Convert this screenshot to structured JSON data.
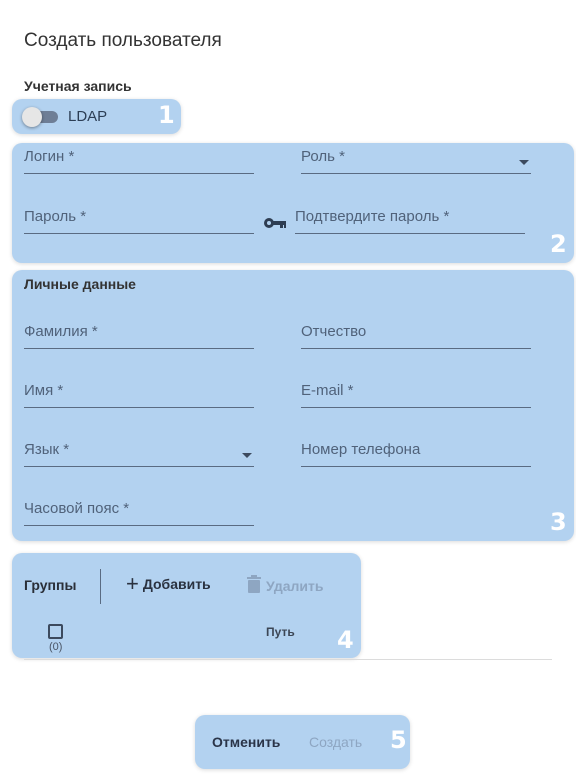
{
  "dialog": {
    "title": "Создать пользователя",
    "account_section": "Учетная запись"
  },
  "ldap": {
    "label": "LDAP",
    "enabled": false
  },
  "account_fields": {
    "login": "Логин *",
    "role": "Роль *",
    "password": "Пароль *",
    "confirm_password": "Подтвердите пароль *"
  },
  "personal": {
    "title": "Личные данные",
    "last_name": "Фамилия *",
    "middle_name": "Отчество",
    "first_name": "Имя *",
    "email": "E-mail *",
    "language": "Язык *",
    "phone": "Номер телефона",
    "timezone": "Часовой пояс *"
  },
  "groups": {
    "title": "Группы",
    "add_label": "Добавить",
    "delete_label": "Удалить",
    "count": "(0)",
    "path_header": "Путь"
  },
  "actions": {
    "cancel_label": "Отменить",
    "create_label": "Создать"
  },
  "callouts": [
    "1",
    "2",
    "3",
    "4",
    "5"
  ],
  "colors": {
    "highlight": "#b3d2f0",
    "field_label": "#50627a",
    "disabled": "#8ea6c2"
  },
  "icons": [
    "key-icon",
    "plus-icon",
    "trash-icon",
    "dropdown-caret-icon",
    "checkbox-icon"
  ]
}
